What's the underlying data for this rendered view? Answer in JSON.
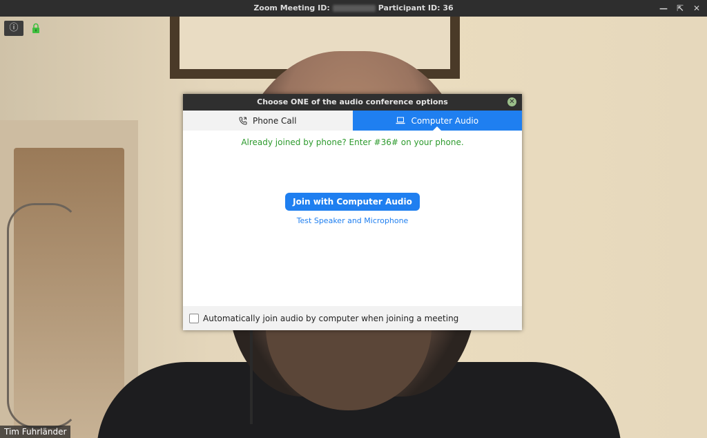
{
  "titlebar": {
    "left": "Zoom Meeting ID:",
    "right": "Participant ID: 36",
    "controls": [
      "minimize-icon",
      "restore-icon",
      "close-icon"
    ]
  },
  "toolbar": {
    "info_icon": "info-icon",
    "lock_icon": "lock-icon"
  },
  "participant": {
    "name": "Tim Fuhrländer"
  },
  "dialog": {
    "title": "Choose ONE of the audio conference options",
    "tabs": [
      {
        "label": "Phone Call",
        "icon": "phone-icon",
        "selected": false
      },
      {
        "label": "Computer Audio",
        "icon": "laptop-icon",
        "selected": true
      }
    ],
    "info_message": "Already joined by phone? Enter #36# on your phone.",
    "join_button": "Join with Computer Audio",
    "test_link": "Test Speaker and Microphone",
    "auto_join_label": "Automatically join audio by computer when joining a meeting",
    "auto_join_checked": false
  },
  "colors": {
    "accent": "#1f7ff0",
    "success": "#2d9a2d"
  }
}
